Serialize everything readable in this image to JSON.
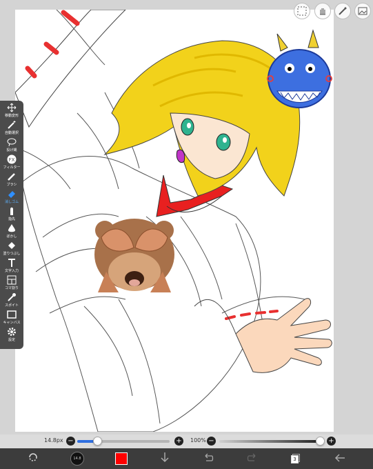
{
  "app": {
    "accent": "#2f8fff",
    "brush_color": "#ff0000"
  },
  "top_tools": {
    "icons": [
      "selection-icon",
      "hand-icon",
      "pen-icon",
      "image-icon"
    ]
  },
  "palette": {
    "tools": [
      {
        "label": "移動変形",
        "icon": "move-icon"
      },
      {
        "label": "自動選択",
        "icon": "magic-wand-icon"
      },
      {
        "label": "投げ縄",
        "icon": "lasso-icon"
      },
      {
        "label": "フィルター",
        "icon": "fx-icon"
      },
      {
        "label": "ブラシ",
        "icon": "brush-icon"
      },
      {
        "label": "消しゴム",
        "icon": "eraser-icon"
      },
      {
        "label": "指先",
        "icon": "finger-icon"
      },
      {
        "label": "ぼかし",
        "icon": "blur-icon"
      },
      {
        "label": "塗りつぶし",
        "icon": "fill-icon"
      },
      {
        "label": "文字入力",
        "icon": "text-icon"
      },
      {
        "label": "コマ割り",
        "icon": "frame-icon"
      },
      {
        "label": "スポイト",
        "icon": "eyedropper-icon"
      },
      {
        "label": "キャンバス",
        "icon": "canvas-icon"
      },
      {
        "label": "設定",
        "icon": "settings-icon"
      }
    ],
    "active_index": 5
  },
  "sliders": {
    "brush_size": "14.8px",
    "brush_size_level": 0.22,
    "opacity": "100%",
    "opacity_level": 1.0
  },
  "bottom_bar": {
    "brush_preview_label": "14.8",
    "layer_count": "3"
  }
}
